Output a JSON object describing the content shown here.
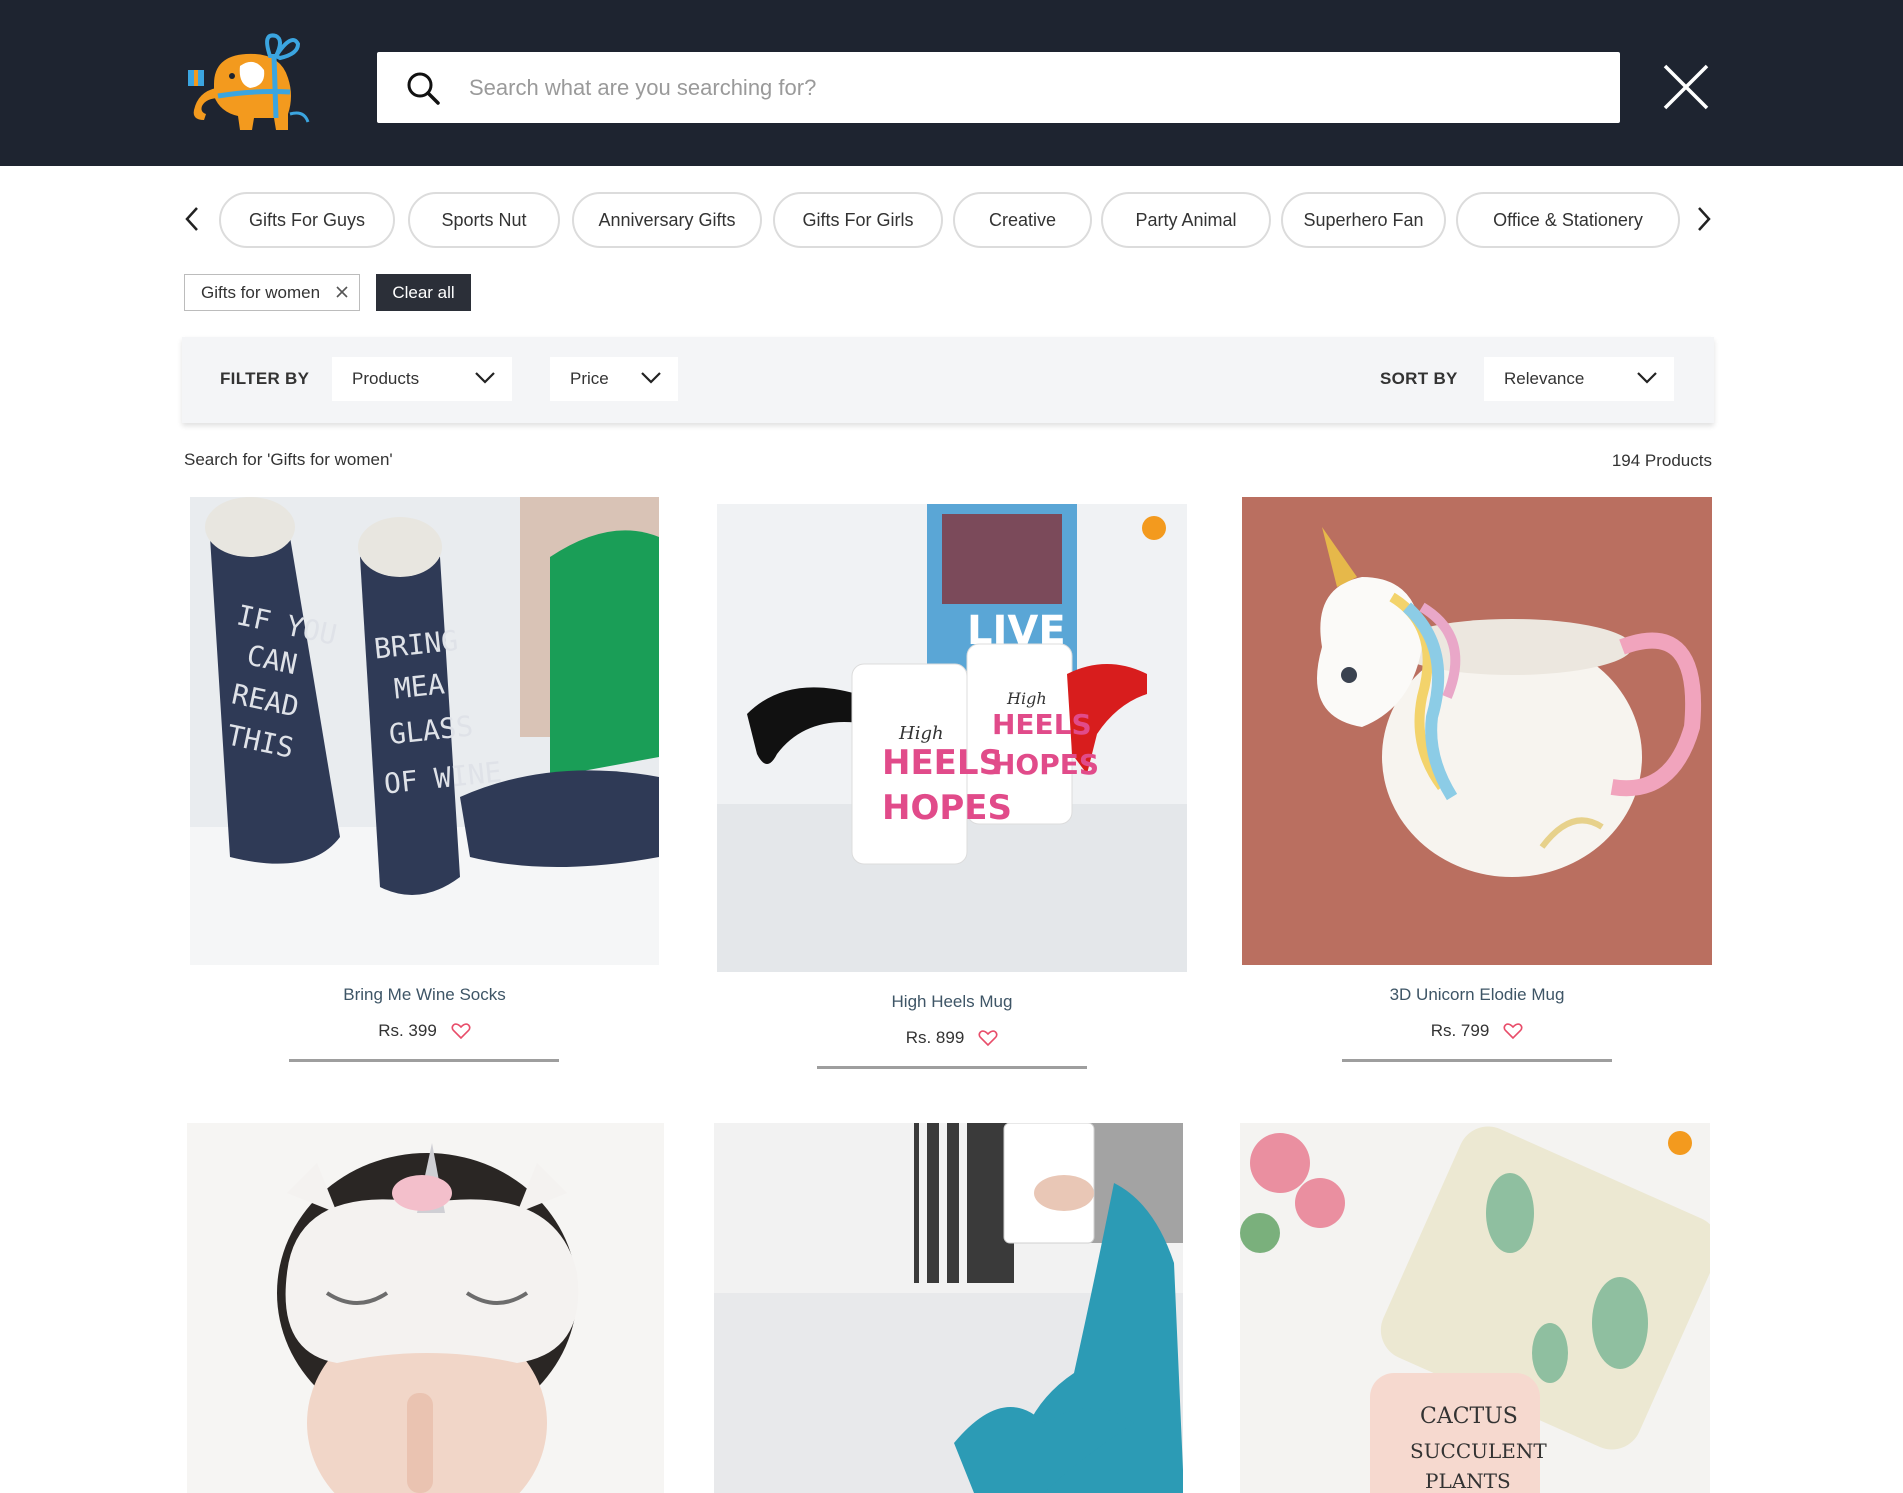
{
  "header": {
    "logo_icon": "elephant-gift-logo",
    "search_placeholder": "Search what are you searching for?",
    "search_value": "",
    "search_icon": "search-icon",
    "close_icon": "close-icon"
  },
  "categories": [
    "Gifts For Guys",
    "Sports Nut",
    "Anniversary Gifts",
    "Gifts For Girls",
    "Creative",
    "Party Animal",
    "Superhero Fan",
    "Office & Stationery"
  ],
  "active_filters": {
    "tags": [
      "Gifts for women"
    ],
    "clear_label": "Clear all"
  },
  "filter_bar": {
    "filter_label": "FILTER BY",
    "products_dropdown": "Products",
    "price_dropdown": "Price",
    "sort_label": "SORT BY",
    "sort_value": "Relevance"
  },
  "results": {
    "query_text": "Search for 'Gifts for women'",
    "count_text": "194 Products"
  },
  "products": [
    {
      "name": "Bring Me Wine Socks",
      "price": "Rs. 399"
    },
    {
      "name": "High Heels Mug",
      "price": "Rs. 899"
    },
    {
      "name": "3D Unicorn Elodie Mug",
      "price": "Rs. 799"
    }
  ],
  "colors": {
    "header_bg": "#1e2430",
    "accent_orange": "#f39a1e",
    "accent_blue": "#3ba5e0",
    "heart": "#e84d6a",
    "product_name": "#3e5566"
  }
}
